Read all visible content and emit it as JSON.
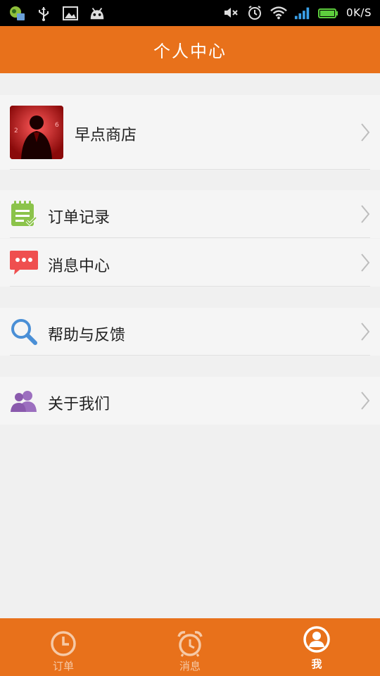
{
  "status_bar": {
    "left_icons": [
      "app-notification-icon",
      "usb-icon",
      "image-icon",
      "android-icon"
    ],
    "right_icons": [
      "mute-icon",
      "alarm-icon",
      "wifi-icon",
      "signal-icon",
      "battery-icon"
    ],
    "net_speed": "0K/S"
  },
  "header": {
    "title": "个人中心"
  },
  "profile": {
    "name": "早点商店",
    "avatar": "avatar-image"
  },
  "menu": {
    "order_records": "订单记录",
    "message_center": "消息中心",
    "help_feedback": "帮助与反馈",
    "about_us": "关于我们"
  },
  "bottom_nav": {
    "tabs": [
      {
        "label": "订单",
        "icon": "clock-icon",
        "active": false
      },
      {
        "label": "消息",
        "icon": "alarm-clock-icon",
        "active": false
      },
      {
        "label": "我",
        "icon": "user-icon",
        "active": true
      }
    ]
  },
  "colors": {
    "accent": "#e8711b",
    "background": "#f0f0f0",
    "row": "#f5f5f5"
  }
}
